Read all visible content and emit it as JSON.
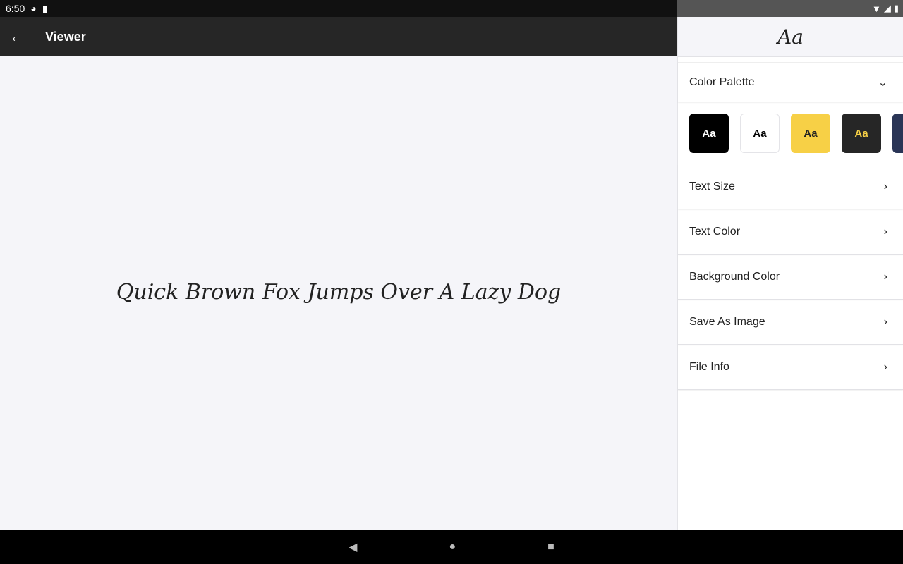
{
  "status": {
    "time": "6:50"
  },
  "appbar": {
    "title": "Viewer"
  },
  "viewer": {
    "sample_text": "Quick Brown Fox Jumps Over A Lazy Dog"
  },
  "panel": {
    "preview": "Aa",
    "color_palette": "Color Palette",
    "swatches": [
      {
        "label": "Aa",
        "bg": "#000000",
        "fg": "#ffffff"
      },
      {
        "label": "Aa",
        "bg": "#ffffff",
        "fg": "#000000"
      },
      {
        "label": "Aa",
        "bg": "#f7d046",
        "fg": "#222222"
      },
      {
        "label": "Aa",
        "bg": "#262626",
        "fg": "#f7d046"
      },
      {
        "label": "",
        "bg": "#2a3556",
        "fg": "#ffffff"
      }
    ],
    "items": [
      "Text Size",
      "Text Color",
      "Background Color",
      "Save As Image",
      "File Info"
    ]
  }
}
